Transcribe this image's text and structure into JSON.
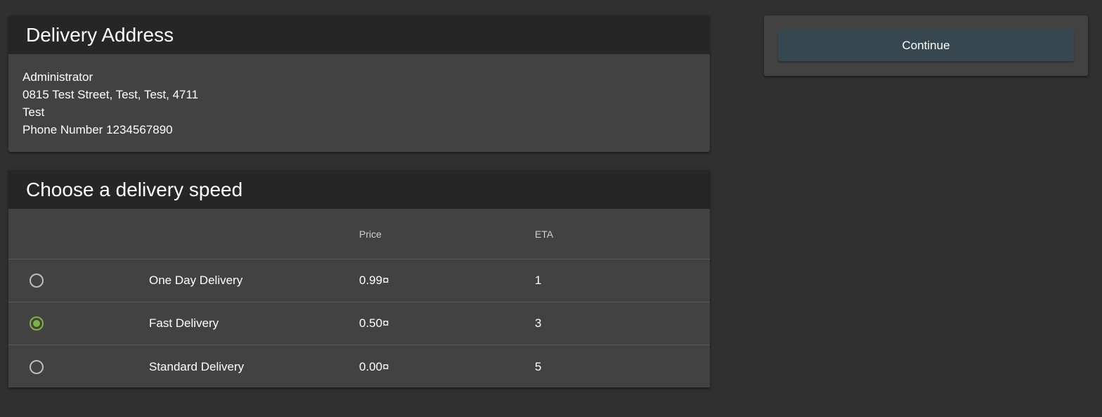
{
  "address": {
    "title": "Delivery Address",
    "name": "Administrator",
    "street": "0815 Test Street, Test, Test, 4711",
    "country": "Test",
    "phone": "Phone Number 1234567890"
  },
  "delivery": {
    "title": "Choose a delivery speed",
    "headers": {
      "price": "Price",
      "eta": "ETA"
    },
    "options": [
      {
        "name": "One Day Delivery",
        "price": "0.99¤",
        "eta": "1",
        "selected": false
      },
      {
        "name": "Fast Delivery",
        "price": "0.50¤",
        "eta": "3",
        "selected": true
      },
      {
        "name": "Standard Delivery",
        "price": "0.00¤",
        "eta": "5",
        "selected": false
      }
    ]
  },
  "actions": {
    "continue_label": "Continue"
  },
  "colors": {
    "background": "#303030",
    "card": "#424242",
    "header": "#262626",
    "accent_green": "#7cb342",
    "button": "#37474f"
  }
}
